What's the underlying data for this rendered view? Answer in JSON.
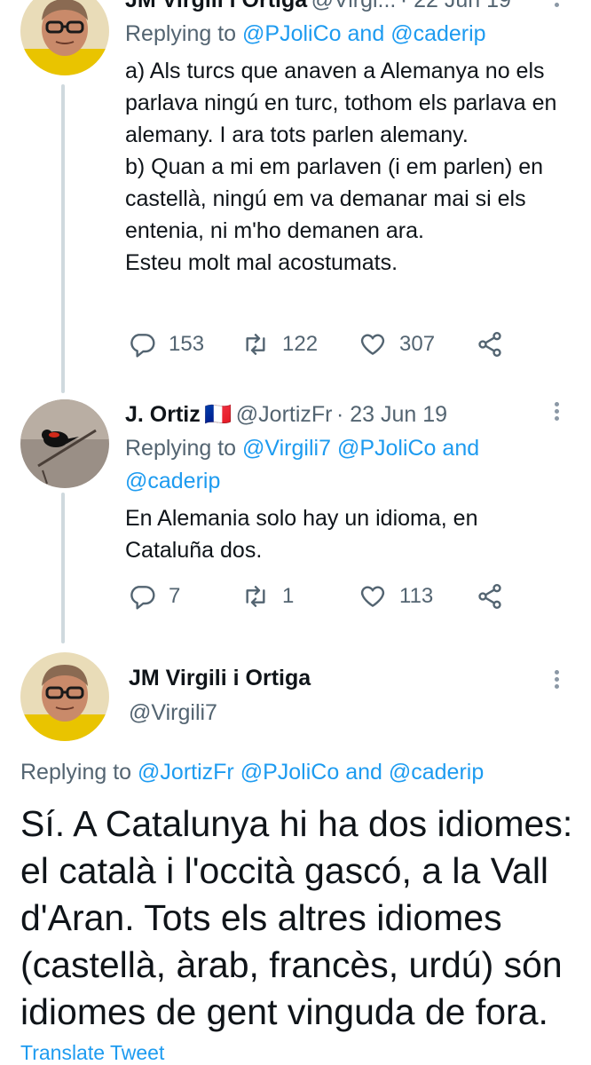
{
  "tweet1": {
    "name_partial": "JM Virgili i Ortiga",
    "handle_partial": "@Virgi...",
    "date_partial": "· 22 Jun 19",
    "replying_prefix": "Replying to",
    "reply_to_1": "@PJoliCo",
    "reply_and": "and",
    "reply_to_2": "@caderip",
    "text": "a) Als turcs que anaven a Alemanya no els parlava ningú en turc, tothom els parlava en alemany. I ara tots parlen alemany.\nb) Quan a mi em parlaven (i em parlen) en castellà, ningú em va demanar mai si els entenia, ni m'ho demanen ara.\nEsteu molt mal acostumats.",
    "replies": "153",
    "retweets": "122",
    "likes": "307"
  },
  "tweet2": {
    "name": "J. Ortiz",
    "flag": "🇫🇷",
    "handle": "@JortizFr",
    "date": "· 23 Jun 19",
    "replying_prefix": "Replying to",
    "reply_to_1": "@Virgili7",
    "reply_to_2": "@PJoliCo",
    "reply_and": "and",
    "reply_to_3": "@caderip",
    "text": "En Alemania solo hay un idioma, en\nCataluña dos.",
    "replies": "7",
    "retweets": "1",
    "likes": "113"
  },
  "main": {
    "name": "JM Virgili i Ortiga",
    "handle": "@Virgili7",
    "replying_prefix": "Replying to",
    "reply_to_1": "@JortizFr",
    "reply_to_2": "@PJoliCo",
    "reply_and": "and",
    "reply_to_3": "@caderip",
    "text_lines": [
      "Sí. A Catalunya hi ha dos idiomes:",
      "el català i l'occità gascó, a la Vall",
      "d'Aran. Tots els altres idiomes",
      "(castellà, àrab, francès, urdú) són",
      "idiomes de gent vinguda de fora."
    ],
    "translate": "Translate Tweet"
  },
  "colors": {
    "link": "#1d9bf0",
    "secondary": "#536471",
    "line": "#cfd9de"
  },
  "icons": [
    "reply-icon",
    "retweet-icon",
    "like-icon",
    "share-icon",
    "more-icon"
  ]
}
